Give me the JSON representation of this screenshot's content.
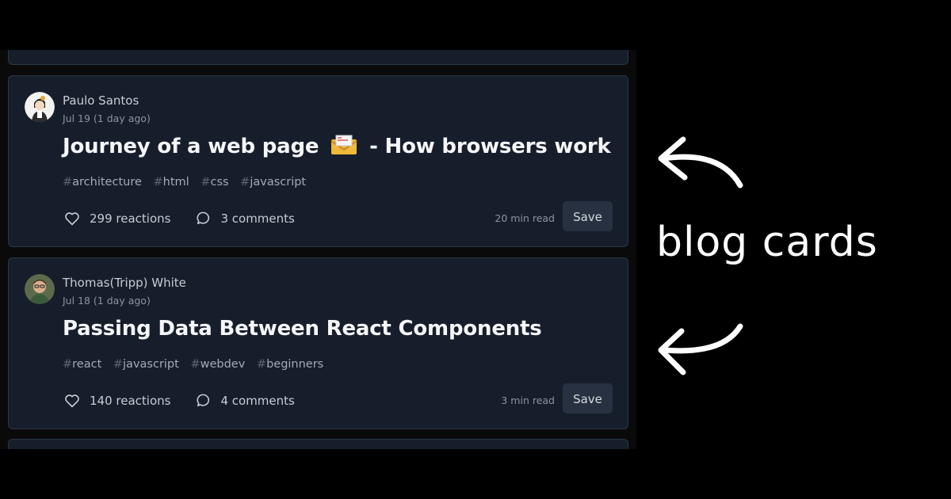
{
  "annotation": {
    "text": "blog cards"
  },
  "posts": [
    {
      "author": "Paulo Santos",
      "date": "Jul 19 (1 day ago)",
      "title_before": "Journey of a web page",
      "title_after": "- How browsers work",
      "tags": [
        "architecture",
        "html",
        "css",
        "javascript"
      ],
      "reactions": "299 reactions",
      "comments": "3 comments",
      "read_time": "20 min read",
      "save_label": "Save"
    },
    {
      "author": "Thomas(Tripp) White",
      "date": "Jul 18 (1 day ago)",
      "title": "Passing Data Between React Components",
      "tags": [
        "react",
        "javascript",
        "webdev",
        "beginners"
      ],
      "reactions": "140 reactions",
      "comments": "4 comments",
      "read_time": "3 min read",
      "save_label": "Save"
    }
  ],
  "colors": {
    "background": "#000000",
    "card": "#171e2b",
    "card_border": "#2b3545",
    "save_button": "#283141"
  }
}
